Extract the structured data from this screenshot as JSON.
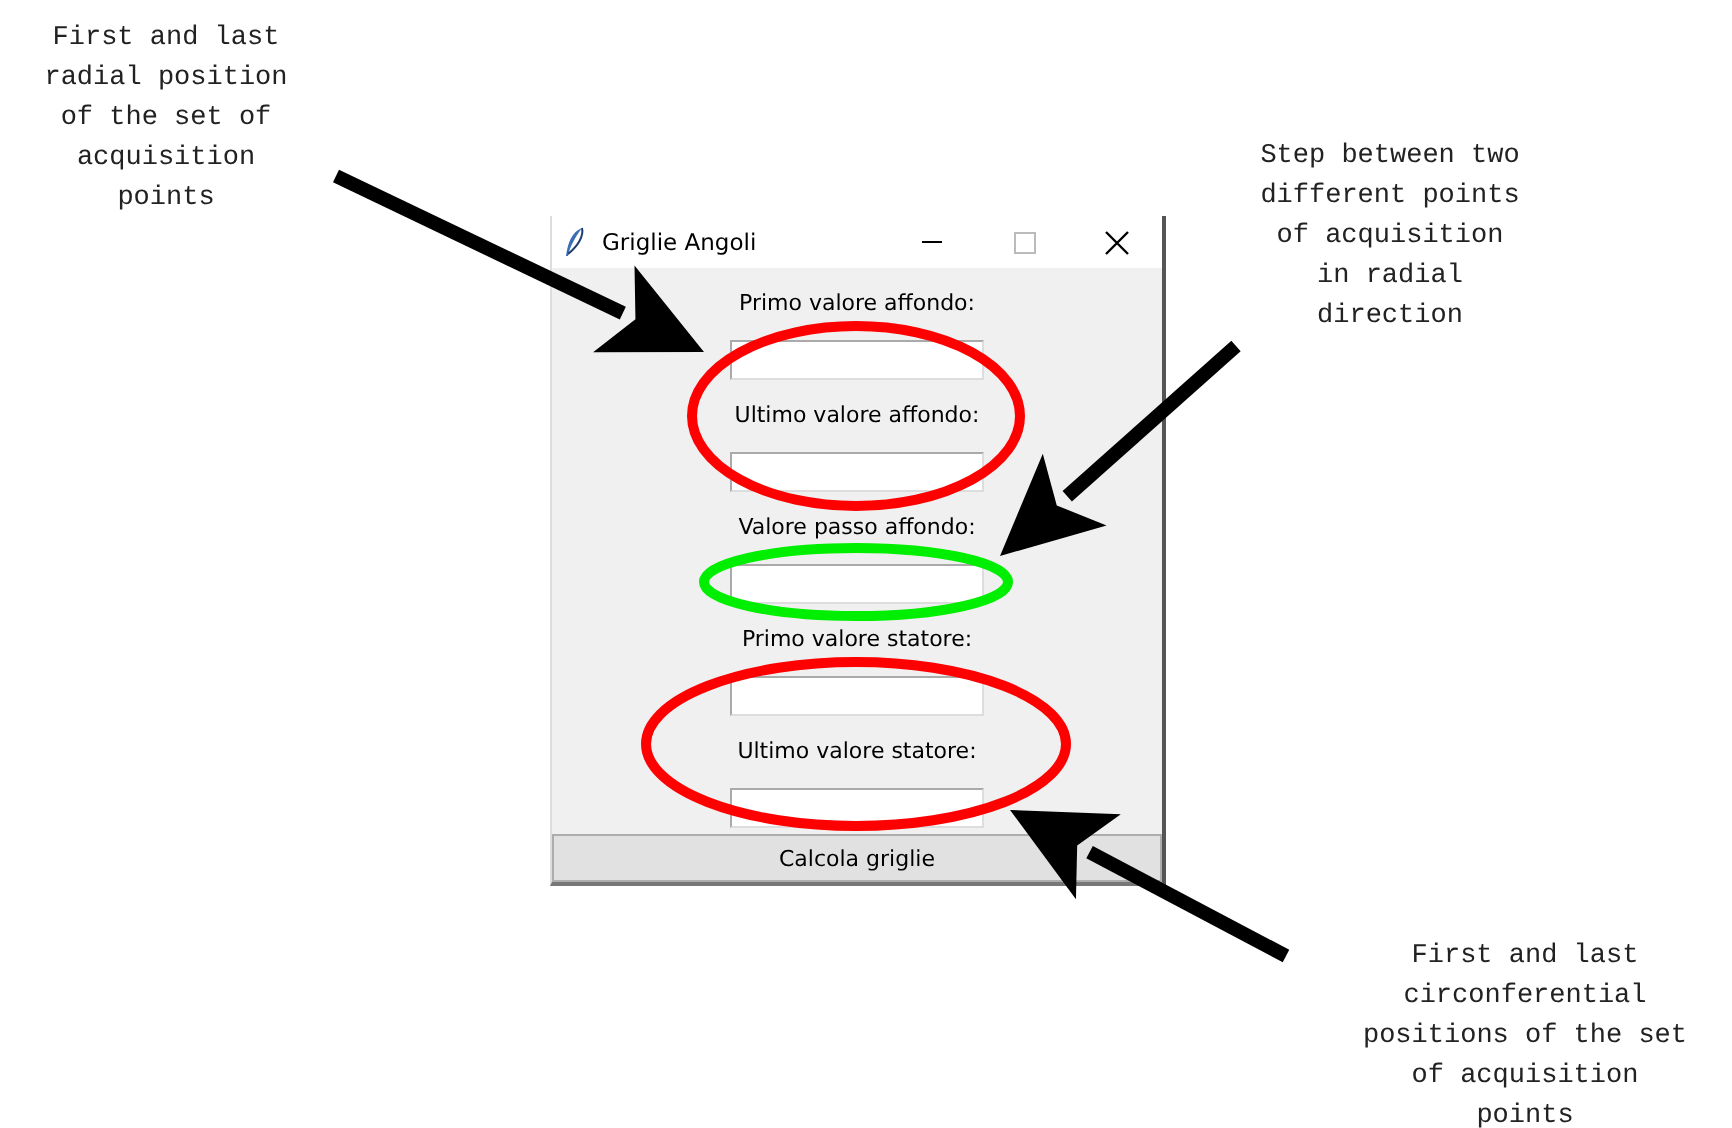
{
  "window": {
    "title": "Griglie Angoli"
  },
  "fields": [
    {
      "label": "Primo valore affondo:"
    },
    {
      "label": "Ultimo valore affondo:"
    },
    {
      "label": "Valore passo affondo:"
    },
    {
      "label": "Primo valore statore:"
    },
    {
      "label": "Ultimo valore statore:"
    }
  ],
  "button": "Calcola griglie",
  "highlights": [
    {
      "color": "#ff0000"
    },
    {
      "color": "#00ee00"
    },
    {
      "color": "#ff0000"
    }
  ],
  "notes": [
    {
      "text": "First and last\nradial position\nof the set of\nacquisition\npoints"
    },
    {
      "text": "Step between two\ndifferent points\nof acquisition\nin radial\ndirection"
    },
    {
      "text": "First and last\ncirconferential\npositions of the set\nof acquisition\npoints"
    }
  ]
}
